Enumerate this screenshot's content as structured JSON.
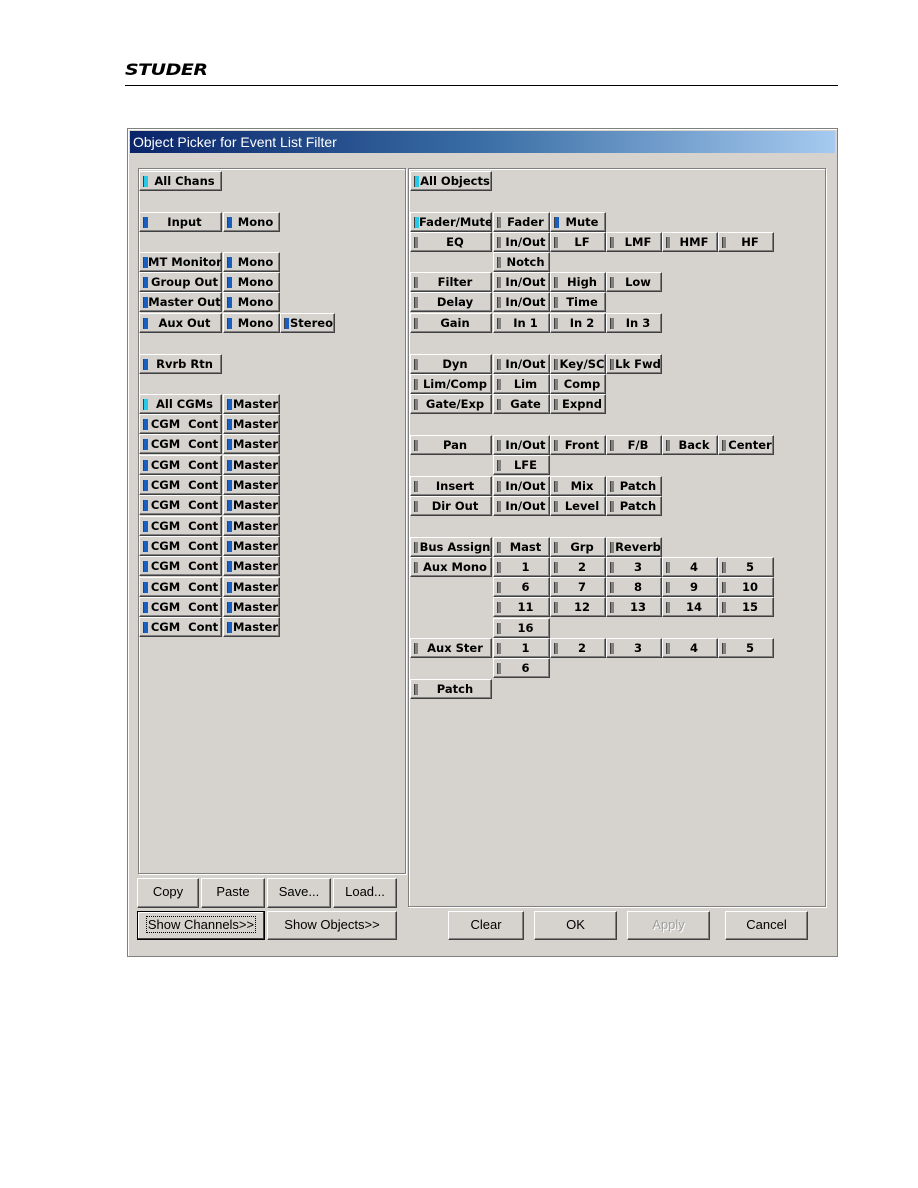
{
  "logo": "STUDER",
  "window": {
    "title": "Object Picker for Event List Filter"
  },
  "colors": {
    "indicator_on": "#1a5fc0",
    "indicator_all": "#28c8e8",
    "indicator_off": "#808080",
    "title_bar": "#0a246a"
  },
  "channels": [
    [
      {
        "label": "All Chans",
        "state": "all"
      }
    ],
    [
      {
        "label": "Input",
        "state": "on"
      },
      {
        "label": "Mono",
        "state": "on"
      }
    ],
    [
      {
        "label": "MT Monitor",
        "state": "on"
      },
      {
        "label": "Mono",
        "state": "on"
      }
    ],
    [
      {
        "label": "Group Out",
        "state": "on"
      },
      {
        "label": "Mono",
        "state": "on"
      }
    ],
    [
      {
        "label": "Master Out",
        "state": "on"
      },
      {
        "label": "Mono",
        "state": "on"
      }
    ],
    [
      {
        "label": "Aux Out",
        "state": "on"
      },
      {
        "label": "Mono",
        "state": "on"
      },
      {
        "label": "Stereo",
        "state": "on"
      }
    ],
    [
      {
        "label": "Rvrb Rtn",
        "state": "on"
      }
    ],
    [
      {
        "label": "All CGMs",
        "state": "all"
      },
      {
        "label": "Master",
        "state": "on"
      }
    ],
    [
      {
        "label": "CGM  Cont",
        "state": "on"
      },
      {
        "label": "Master",
        "state": "on"
      }
    ],
    [
      {
        "label": "CGM  Cont",
        "state": "on"
      },
      {
        "label": "Master",
        "state": "on"
      }
    ],
    [
      {
        "label": "CGM  Cont",
        "state": "on"
      },
      {
        "label": "Master",
        "state": "on"
      }
    ],
    [
      {
        "label": "CGM  Cont",
        "state": "on"
      },
      {
        "label": "Master",
        "state": "on"
      }
    ],
    [
      {
        "label": "CGM  Cont",
        "state": "on"
      },
      {
        "label": "Master",
        "state": "on"
      }
    ],
    [
      {
        "label": "CGM  Cont",
        "state": "on"
      },
      {
        "label": "Master",
        "state": "on"
      }
    ],
    [
      {
        "label": "CGM  Cont",
        "state": "on"
      },
      {
        "label": "Master",
        "state": "on"
      }
    ],
    [
      {
        "label": "CGM  Cont",
        "state": "on"
      },
      {
        "label": "Master",
        "state": "on"
      }
    ],
    [
      {
        "label": "CGM  Cont",
        "state": "on"
      },
      {
        "label": "Master",
        "state": "on"
      }
    ],
    [
      {
        "label": "CGM  Cont",
        "state": "on"
      },
      {
        "label": "Master",
        "state": "on"
      }
    ],
    [
      {
        "label": "CGM  Cont",
        "state": "on"
      },
      {
        "label": "Master",
        "state": "on"
      }
    ]
  ],
  "objects": [
    [
      {
        "label": "All Objects",
        "state": "all"
      }
    ],
    [
      {
        "label": "Fader/Mute",
        "state": "all"
      },
      {
        "label": "Fader",
        "state": "off"
      },
      {
        "label": "Mute",
        "state": "on"
      }
    ],
    [
      {
        "label": "EQ",
        "state": "off"
      },
      {
        "label": "In/Out",
        "state": "off"
      },
      {
        "label": "LF",
        "state": "off"
      },
      {
        "label": "LMF",
        "state": "off"
      },
      {
        "label": "HMF",
        "state": "off"
      },
      {
        "label": "HF",
        "state": "off"
      }
    ],
    [
      null,
      {
        "label": "Notch",
        "state": "off"
      }
    ],
    [
      {
        "label": "Filter",
        "state": "off"
      },
      {
        "label": "In/Out",
        "state": "off"
      },
      {
        "label": "High",
        "state": "off"
      },
      {
        "label": "Low",
        "state": "off"
      }
    ],
    [
      {
        "label": "Delay",
        "state": "off"
      },
      {
        "label": "In/Out",
        "state": "off"
      },
      {
        "label": "Time",
        "state": "off"
      }
    ],
    [
      {
        "label": "Gain",
        "state": "off"
      },
      {
        "label": "In 1",
        "state": "off"
      },
      {
        "label": "In 2",
        "state": "off"
      },
      {
        "label": "In 3",
        "state": "off"
      }
    ],
    [
      {
        "label": "Dyn",
        "state": "off"
      },
      {
        "label": "In/Out",
        "state": "off"
      },
      {
        "label": "Key/SC",
        "state": "off"
      },
      {
        "label": "Lk Fwd",
        "state": "off"
      }
    ],
    [
      {
        "label": "Lim/Comp",
        "state": "off"
      },
      {
        "label": "Lim",
        "state": "off"
      },
      {
        "label": "Comp",
        "state": "off"
      }
    ],
    [
      {
        "label": "Gate/Exp",
        "state": "off"
      },
      {
        "label": "Gate",
        "state": "off"
      },
      {
        "label": "Expnd",
        "state": "off"
      }
    ],
    [
      {
        "label": "Pan",
        "state": "off"
      },
      {
        "label": "In/Out",
        "state": "off"
      },
      {
        "label": "Front",
        "state": "off"
      },
      {
        "label": "F/B",
        "state": "off"
      },
      {
        "label": "Back",
        "state": "off"
      },
      {
        "label": "Center",
        "state": "off"
      }
    ],
    [
      null,
      {
        "label": "LFE",
        "state": "off"
      }
    ],
    [
      {
        "label": "Insert",
        "state": "off"
      },
      {
        "label": "In/Out",
        "state": "off"
      },
      {
        "label": "Mix",
        "state": "off"
      },
      {
        "label": "Patch",
        "state": "off"
      }
    ],
    [
      {
        "label": "Dir Out",
        "state": "off"
      },
      {
        "label": "In/Out",
        "state": "off"
      },
      {
        "label": "Level",
        "state": "off"
      },
      {
        "label": "Patch",
        "state": "off"
      }
    ],
    [
      {
        "label": "Bus Assign",
        "state": "off"
      },
      {
        "label": "Mast",
        "state": "off"
      },
      {
        "label": "Grp",
        "state": "off"
      },
      {
        "label": "Reverb",
        "state": "off"
      }
    ],
    [
      {
        "label": "Aux Mono",
        "state": "off"
      },
      {
        "label": "1",
        "state": "off"
      },
      {
        "label": "2",
        "state": "off"
      },
      {
        "label": "3",
        "state": "off"
      },
      {
        "label": "4",
        "state": "off"
      },
      {
        "label": "5",
        "state": "off"
      }
    ],
    [
      null,
      {
        "label": "6",
        "state": "off"
      },
      {
        "label": "7",
        "state": "off"
      },
      {
        "label": "8",
        "state": "off"
      },
      {
        "label": "9",
        "state": "off"
      },
      {
        "label": "10",
        "state": "off"
      }
    ],
    [
      null,
      {
        "label": "11",
        "state": "off"
      },
      {
        "label": "12",
        "state": "off"
      },
      {
        "label": "13",
        "state": "off"
      },
      {
        "label": "14",
        "state": "off"
      },
      {
        "label": "15",
        "state": "off"
      }
    ],
    [
      null,
      {
        "label": "16",
        "state": "off"
      }
    ],
    [
      {
        "label": "Aux Ster",
        "state": "off"
      },
      {
        "label": "1",
        "state": "off"
      },
      {
        "label": "2",
        "state": "off"
      },
      {
        "label": "3",
        "state": "off"
      },
      {
        "label": "4",
        "state": "off"
      },
      {
        "label": "5",
        "state": "off"
      }
    ],
    [
      null,
      {
        "label": "6",
        "state": "off"
      }
    ],
    [
      {
        "label": "Patch",
        "state": "off"
      }
    ]
  ],
  "buttons": {
    "copy": "Copy",
    "paste": "Paste",
    "save": "Save...",
    "load": "Load...",
    "show_channels": "Show Channels>>",
    "show_objects": "Show Objects>>",
    "clear": "Clear",
    "ok": "OK",
    "apply": "Apply",
    "cancel": "Cancel"
  }
}
